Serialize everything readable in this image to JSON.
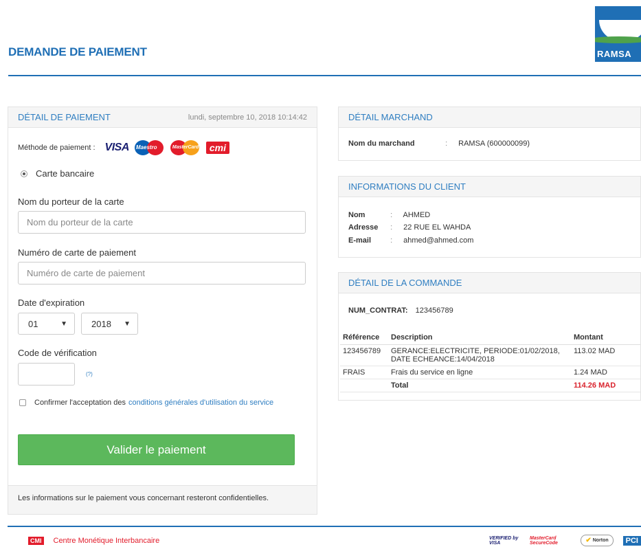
{
  "header": {
    "title": "DEMANDE DE PAIEMENT",
    "logo_text": "RAMSA",
    "accent_color": "#1f6fb5"
  },
  "payment": {
    "section_title": "DÉTAIL DE PAIEMENT",
    "datetime": "lundi, septembre 10, 2018 10:14:42",
    "method_label": "Méthode de paiement :",
    "brands": {
      "visa": "VISA",
      "maestro": "Maestro",
      "mastercard": "MasterCard",
      "cmi": "cmi"
    },
    "radio_label": "Carte bancaire",
    "cardholder_label": "Nom du porteur de la carte",
    "cardholder_placeholder": "Nom du porteur de la carte",
    "card_number_label": "Numéro de carte de paiement",
    "card_number_placeholder": "Numéro de carte de paiement",
    "expiry_label": "Date d'expiration",
    "expiry_month": "01",
    "expiry_year": "2018",
    "cvv_label": "Code de vérification",
    "cvv_help": "(?)",
    "terms_text": "Confirmer l'acceptation des",
    "terms_link": "conditions générales d'utilisation du service",
    "submit_label": "Valider le paiement",
    "footer_note": "Les informations sur le paiement vous concernant resteront confidentielles.",
    "submit_color": "#5cb85c"
  },
  "merchant": {
    "section_title": "DÉTAIL MARCHAND",
    "name_label": "Nom du marchand",
    "name_value": "RAMSA (600000099)"
  },
  "client": {
    "section_title": "INFORMATIONS DU CLIENT",
    "nom_label": "Nom",
    "nom_value": "AHMED",
    "adresse_label": "Adresse",
    "adresse_value": "22 RUE EL WAHDA",
    "email_label": "E-mail",
    "email_value": "ahmed@ahmed.com"
  },
  "order": {
    "section_title": "DÉTAIL DE LA COMMANDE",
    "contract_label": "NUM_CONTRAT:",
    "contract_value": "123456789",
    "headers": {
      "ref": "Référence",
      "desc": "Description",
      "amount": "Montant"
    },
    "rows": [
      {
        "ref": "123456789",
        "desc": "GERANCE:ELECTRICITE, PERIODE:01/02/2018, DATE ECHEANCE:14/04/2018",
        "amount": "113.02 MAD"
      },
      {
        "ref": "FRAIS",
        "desc": "Frais du service en ligne",
        "amount": "1.24 MAD"
      }
    ],
    "total_label": "Total",
    "total_value": "114.26 MAD",
    "total_color": "#d9232d"
  },
  "footer": {
    "cmi_logo": "CMI",
    "cmi_name": "Centre Monétique Interbancaire",
    "badges": {
      "visa": "VERIFIED by VISA",
      "mastercard": "MasterCard SecureCode",
      "norton": "Norton",
      "pci": "PCI"
    }
  }
}
